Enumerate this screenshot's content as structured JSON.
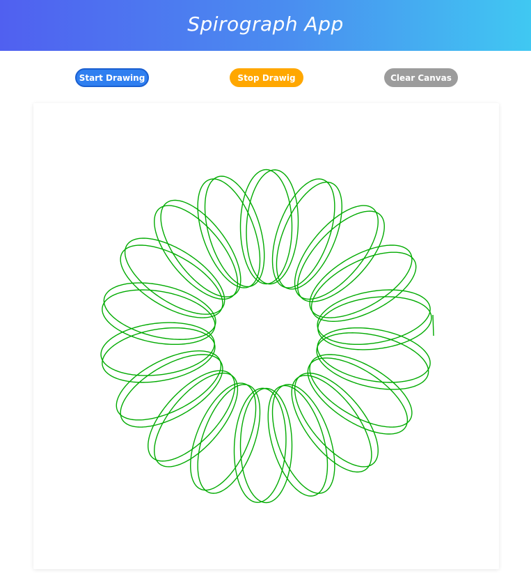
{
  "app": {
    "title": "Spirograph App"
  },
  "controls": {
    "start_label": "Start Drawing",
    "stop_label": "Stop Drawig",
    "clear_label": "Clear Canvas"
  },
  "colors": {
    "header_gradient_start": "#5060f0",
    "header_gradient_end": "#40c8f2",
    "start_button": "#2f7ff0",
    "stop_button": "#ffa700",
    "clear_button": "#9c9c9c",
    "stroke": "#00aa00"
  },
  "canvas": {
    "drawing": "spirograph-rosette"
  }
}
